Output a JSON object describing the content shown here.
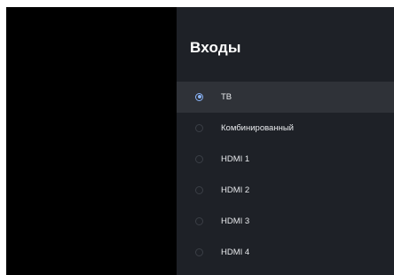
{
  "panel": {
    "title": "Входы"
  },
  "inputs": [
    {
      "label": "ТВ",
      "selected": true
    },
    {
      "label": "Комбинированный",
      "selected": false
    },
    {
      "label": "HDMI 1",
      "selected": false
    },
    {
      "label": "HDMI 2",
      "selected": false
    },
    {
      "label": "HDMI 3",
      "selected": false
    },
    {
      "label": "HDMI 4",
      "selected": false
    }
  ],
  "colors": {
    "panel_background": "#1e2127",
    "selected_row": "#2f3238",
    "accent_radio": "#8ab4f8",
    "text": "#e8eaed"
  }
}
